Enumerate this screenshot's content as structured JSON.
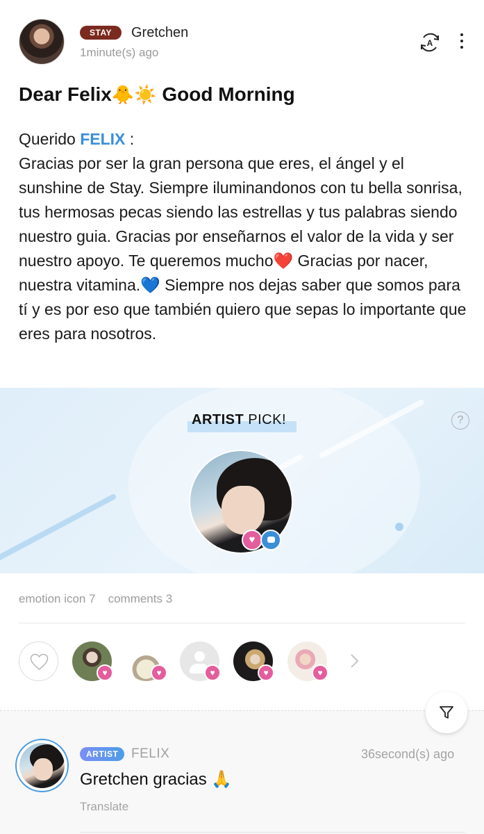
{
  "post": {
    "author_badge": "STAY",
    "author_name": "Gretchen",
    "time": "1minute(s) ago",
    "title_prefix": "Dear Felix",
    "title_emojis": "🐥☀️",
    "title_suffix": "Good Morning",
    "body": {
      "greeting_prefix": "Querido ",
      "greeting_mention": "FELIX",
      "greeting_suffix": "  :",
      "para_part1": "Gracias por ser la gran persona que eres, el ángel y el sunshine de Stay. Siempre iluminandonos con tu bella sonrisa, tus hermosas pecas siendo las estrellas y tus palabras siendo nuestro guia. Gracias por enseñarnos el valor de la vida y ser nuestro apoyo. Te queremos mucho",
      "heart1": "❤️",
      "para_part2": " Gracias por nacer, nuestra vitamina.",
      "heart2": "💙",
      "para_part3": " Siempre nos dejas saber que somos para tí y es por eso que también quiero que sepas lo importante que eres para nosotros."
    }
  },
  "artist_pick": {
    "title_bold": "ARTIST",
    "title_rest": " PICK!",
    "help_symbol": "?"
  },
  "stats": {
    "emotion": "emotion icon 7",
    "comments": "comments 3"
  },
  "reactions": {
    "heart_glyph": "♥",
    "count_visible": 5
  },
  "comment": {
    "badge": "ARTIST",
    "author": "FELIX",
    "time": "36second(s) ago",
    "text": "Gretchen gracias 🙏",
    "translate": "Translate"
  },
  "colors": {
    "stay_badge": "#7b2a1f",
    "mention": "#3a8fd8",
    "reaction_heart": "#e45d9c",
    "artist_badge": "#5b96e8",
    "banner_bg": "#dfeef9"
  },
  "icons": {
    "translate": "translate-icon",
    "more": "more-vertical-icon",
    "help": "help-icon",
    "like": "heart-outline-icon",
    "next": "chevron-right-icon",
    "filter": "filter-icon"
  }
}
